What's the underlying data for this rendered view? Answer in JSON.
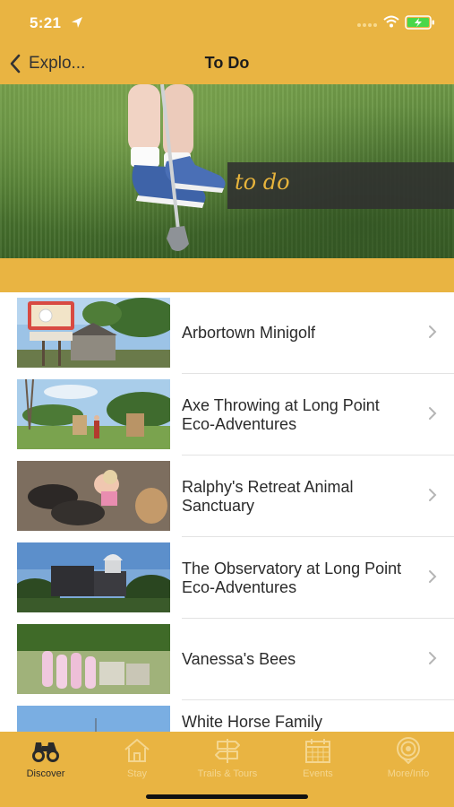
{
  "status_bar": {
    "time": "5:21",
    "text_color": "#ffffff"
  },
  "nav": {
    "back_label": "Explo...",
    "title": "To Do"
  },
  "hero": {
    "label": "to do",
    "label_color": "#e7b43c"
  },
  "list": {
    "items": [
      {
        "title": "Arbortown Minigolf"
      },
      {
        "title": "Axe Throwing at Long Point Eco-Adventures"
      },
      {
        "title": "Ralphy's Retreat Animal Sanctuary"
      },
      {
        "title": "The Observatory at Long Point Eco-Adventures"
      },
      {
        "title": "Vanessa's Bees"
      },
      {
        "title": "White Horse Family"
      }
    ]
  },
  "tab_bar": {
    "tabs": [
      {
        "label": "Discover",
        "icon": "binoculars-icon",
        "active": true
      },
      {
        "label": "Stay",
        "icon": "house-icon",
        "active": false
      },
      {
        "label": "Trails & Tours",
        "icon": "signpost-icon",
        "active": false
      },
      {
        "label": "Events",
        "icon": "calendar-icon",
        "active": false
      },
      {
        "label": "More/Info",
        "icon": "info-ring-icon",
        "active": false
      }
    ]
  },
  "colors": {
    "brand_gold": "#e9b442",
    "active_tab": "#2a2a2a",
    "inactive_tab": "#f4d68f"
  }
}
